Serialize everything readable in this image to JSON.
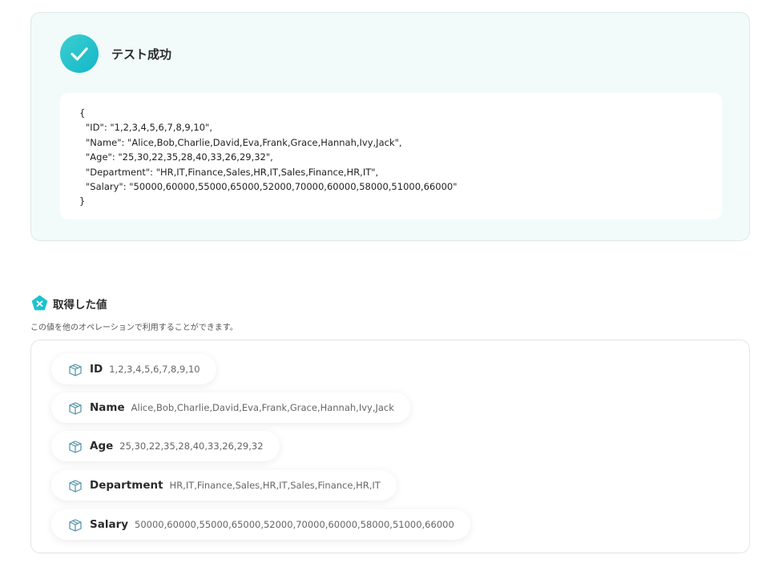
{
  "result": {
    "title": "テスト成功",
    "json_lines": [
      "{",
      "\"ID\": \"1,2,3,4,5,6,7,8,9,10\",",
      "\"Name\": \"Alice,Bob,Charlie,David,Eva,Frank,Grace,Hannah,Ivy,Jack\",",
      "\"Age\": \"25,30,22,35,28,40,33,26,29,32\",",
      "\"Department\": \"HR,IT,Finance,Sales,HR,IT,Sales,Finance,HR,IT\",",
      "\"Salary\": \"50000,60000,55000,65000,52000,70000,60000,58000,51000,66000\"",
      "}"
    ]
  },
  "values": {
    "title": "取得した値",
    "description": "この値を他のオペレーションで利用することができます。",
    "items": [
      {
        "key": "ID",
        "value": "1,2,3,4,5,6,7,8,9,10"
      },
      {
        "key": "Name",
        "value": "Alice,Bob,Charlie,David,Eva,Frank,Grace,Hannah,Ivy,Jack"
      },
      {
        "key": "Age",
        "value": "25,30,22,35,28,40,33,26,29,32"
      },
      {
        "key": "Department",
        "value": "HR,IT,Finance,Sales,HR,IT,Sales,Finance,HR,IT"
      },
      {
        "key": "Salary",
        "value": "50000,60000,55000,65000,52000,70000,60000,58000,51000,66000"
      }
    ]
  },
  "colors": {
    "accent": "#1ec2cc",
    "card_bg": "#f2fafa"
  },
  "icons": {
    "success": "check-icon",
    "values": "pentagon-x-icon",
    "item": "box-icon"
  }
}
